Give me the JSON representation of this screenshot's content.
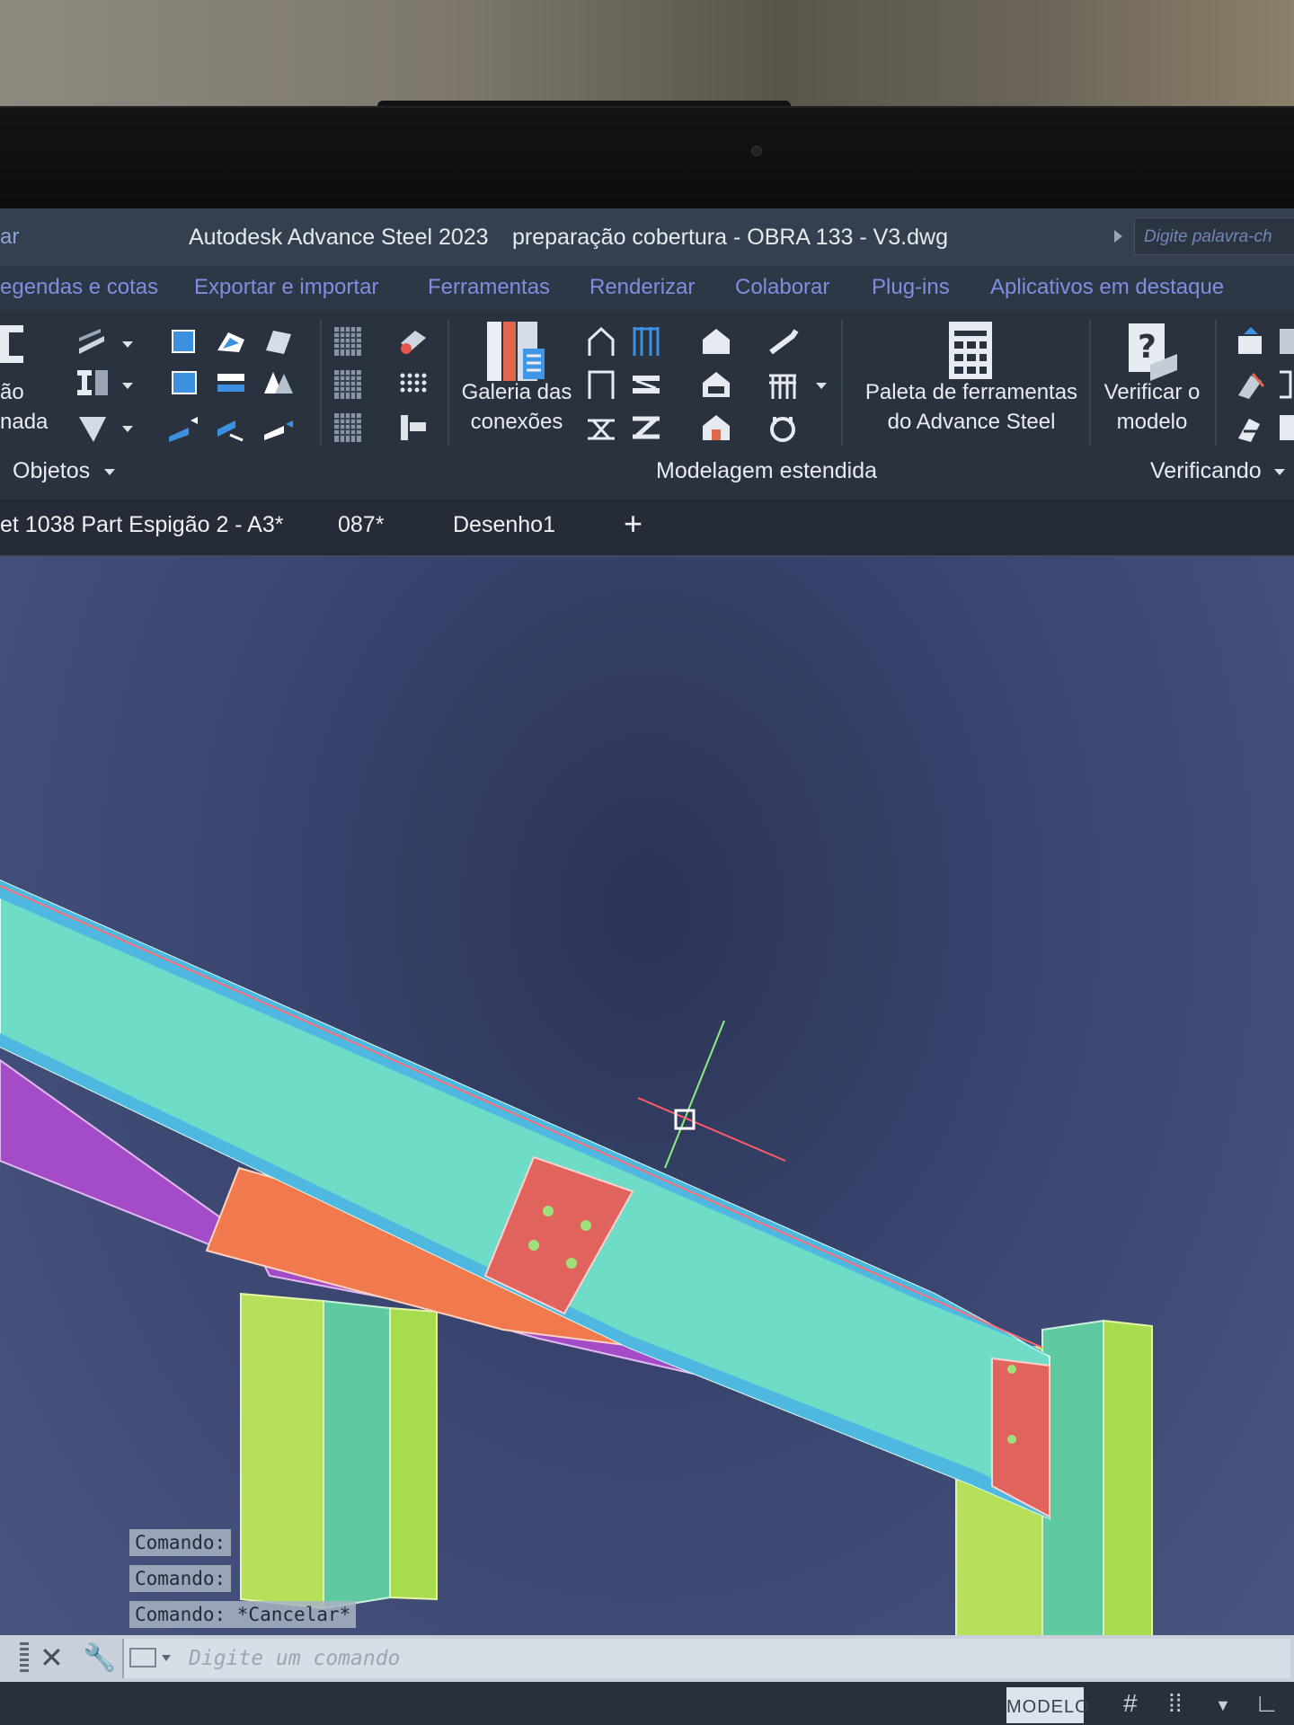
{
  "title_bar": {
    "left_fragment": "ar",
    "app_name": "Autodesk Advance Steel 2023",
    "file_name": "preparação cobertura - OBRA 133 - V3.dwg",
    "search_placeholder": "Digite palavra-ch"
  },
  "ribbon_tabs": [
    "egendas e cotas",
    "Exportar e importar",
    "Ferramentas",
    "Renderizar",
    "Colaborar",
    "Plug-ins",
    "Aplicativos em destaque"
  ],
  "ribbon": {
    "left_big_label_line1": "ão",
    "left_big_label_line2": "nada",
    "galeria_line1": "Galeria das",
    "galeria_line2": "conexões",
    "paleta_line1": "Paleta de ferramentas",
    "paleta_line2": "do Advance Steel",
    "verificar_line1": "Verificar o",
    "verificar_line2": "modelo",
    "group_objetos": "Objetos",
    "group_modelagem": "Modelagem estendida",
    "group_verificando": "Verificando"
  },
  "document_tabs": [
    "et 1038 Part Espigão 2 - A3*",
    "087*",
    "Desenho1"
  ],
  "command_history": [
    "Comando:",
    "Comando:",
    "Comando: *Cancelar*"
  ],
  "command_input_placeholder": "Digite um comando",
  "status_bar": {
    "model_label": "MODELO"
  },
  "colors": {
    "viewport_bg": "#3a4670",
    "beam_cyan": "#6fdcc8",
    "plate_red": "#e0635e",
    "column_green": "#b6e05a",
    "haunch_orange": "#f07a4e",
    "purple_member": "#a44cc8"
  }
}
